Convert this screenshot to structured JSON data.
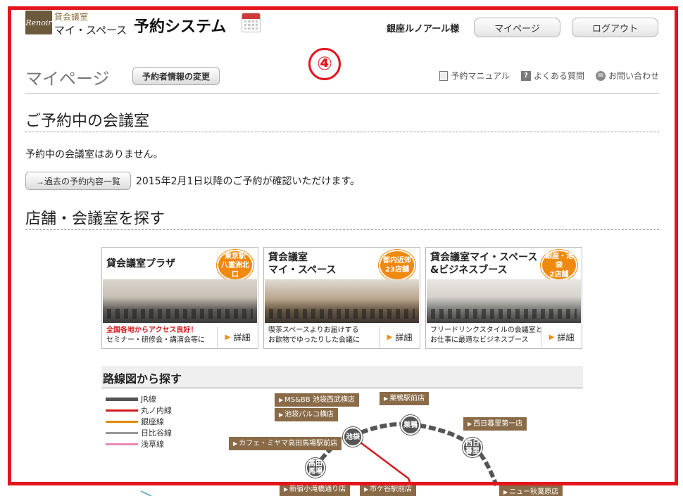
{
  "header": {
    "logo_text": "Renoir",
    "brand_sub": "貸会議室",
    "brand_name": "マイ・スペース",
    "system_title": "予約システム",
    "user_name": "銀座ルノアール様",
    "mypage_label": "マイページ",
    "logout_label": "ログアウト"
  },
  "annotation_mark": "④",
  "page": {
    "title": "マイページ",
    "edit_button": "予約者情報の変更",
    "help_links": [
      {
        "label": "予約マニュアル",
        "icon": "manual-icon"
      },
      {
        "label": "よくある質問",
        "icon": "question-icon"
      },
      {
        "label": "お問い合わせ",
        "icon": "contact-icon"
      }
    ]
  },
  "reservations": {
    "heading": "ご予約中の会議室",
    "empty_message": "予約中の会議室はありません。",
    "history_button": "→過去の予約内容一覧",
    "history_note": "2015年2月1日以降のご予約が確認いただけます。"
  },
  "search": {
    "heading": "店舗・会議室を探す",
    "cards": [
      {
        "title": "貸会議室プラザ",
        "badge": "東京駅\n八重洲北口",
        "desc_red": "全国各地からアクセス良好！",
        "desc": "セミナー・研修会・講演会等に",
        "more": "詳細"
      },
      {
        "title": "貸会議室\nマイ・スペース",
        "badge": "都内近郊\n23店舗",
        "desc_red": "",
        "desc": "喫茶スペースよりお届けする\nお飲物でゆったりした会議に",
        "more": "詳細"
      },
      {
        "title": "貸会議室マイ・スペース\n&ビジネスブース",
        "badge": "銀座・池袋\n2店舗",
        "desc_red": "",
        "desc": "フリードリンクスタイルの会議室と\nお仕事に最適なビジネスブース",
        "more": "詳細"
      }
    ]
  },
  "route_map": {
    "heading": "路線図から探す",
    "legend": [
      {
        "label": "JR線",
        "color": "#555555"
      },
      {
        "label": "丸ノ内線",
        "color": "#d21a1a"
      },
      {
        "label": "銀座線",
        "color": "#e08a00"
      },
      {
        "label": "日比谷線",
        "color": "#999999"
      },
      {
        "label": "浅草線",
        "color": "#e88ab0"
      }
    ],
    "shop_labels": [
      "MS&BB 池袋西武横店",
      "池袋パルコ横店",
      "巣鴨駅前店",
      "西日暮里第一店",
      "カフェ・ミヤマ高田馬場駅前店",
      "新宿小滝橋通り店",
      "市ケ谷駅前店",
      "ニュー秋葉原店"
    ],
    "stations": [
      "池袋",
      "巣鴨",
      "西日\n暮里",
      "高田\n馬場"
    ]
  }
}
